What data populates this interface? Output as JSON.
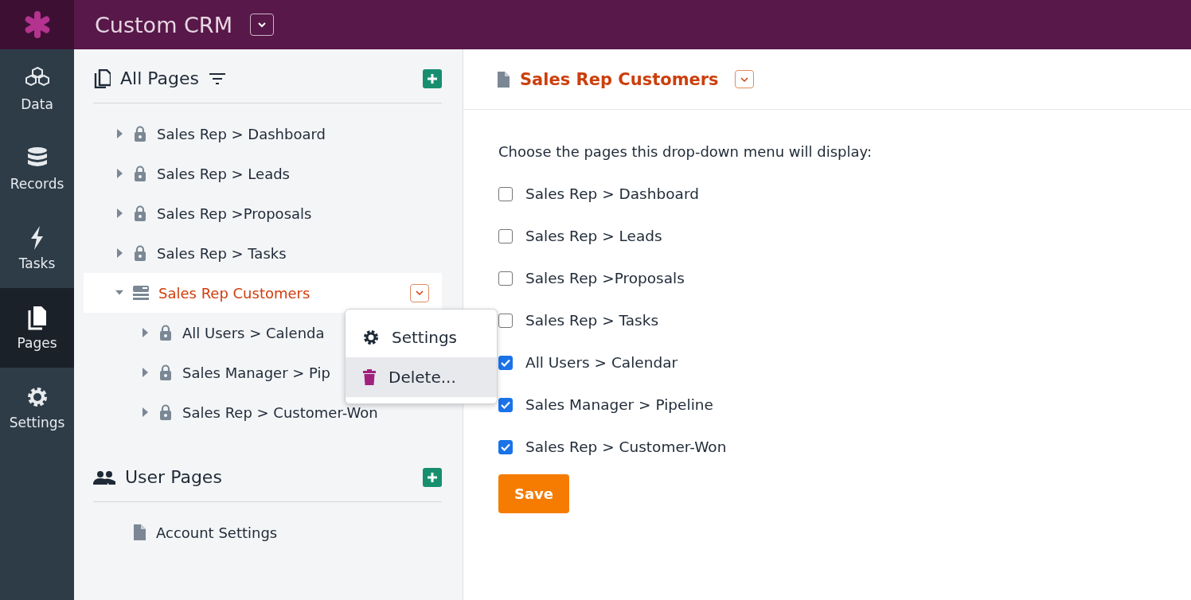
{
  "app": {
    "title": "Custom CRM"
  },
  "nav": [
    {
      "label": "Data",
      "kind": "data",
      "selected": false
    },
    {
      "label": "Records",
      "kind": "records",
      "selected": false
    },
    {
      "label": "Tasks",
      "kind": "tasks",
      "selected": false
    },
    {
      "label": "Pages",
      "kind": "pages",
      "selected": true
    },
    {
      "label": "Settings",
      "kind": "settings",
      "selected": false
    }
  ],
  "sections": [
    {
      "title": "All Pages",
      "kind": "pages",
      "items": [
        {
          "label": "Sales Rep > Dashboard",
          "kind": "locked",
          "expanded": false,
          "selected": false
        },
        {
          "label": "Sales Rep > Leads",
          "kind": "locked",
          "expanded": false,
          "selected": false
        },
        {
          "label": "Sales Rep >Proposals",
          "kind": "locked",
          "expanded": false,
          "selected": false
        },
        {
          "label": "Sales Rep > Tasks",
          "kind": "locked",
          "expanded": false,
          "selected": false
        },
        {
          "label": "Sales Rep Customers",
          "kind": "menu",
          "expanded": true,
          "selected": true,
          "children": [
            {
              "label": "All Users > Calenda",
              "kind": "locked",
              "expanded": false,
              "selected": false
            },
            {
              "label": "Sales Manager > Pip",
              "kind": "locked",
              "expanded": false,
              "selected": false
            },
            {
              "label": "Sales Rep > Customer-Won",
              "kind": "locked",
              "expanded": false,
              "selected": false
            }
          ]
        }
      ]
    },
    {
      "title": "User Pages",
      "kind": "users",
      "items": [
        {
          "label": "Account Settings",
          "kind": "page",
          "selected": false
        }
      ]
    }
  ],
  "context_menu": [
    {
      "label": "Settings",
      "kind": "settings",
      "selected": false
    },
    {
      "label": "Delete...",
      "kind": "delete",
      "selected": true
    }
  ],
  "main": {
    "title": "Sales Rep Customers",
    "prompt": "Choose the pages this drop-down menu will display:",
    "options": [
      {
        "label": "Sales Rep > Dashboard",
        "checked": false
      },
      {
        "label": "Sales Rep > Leads",
        "checked": false
      },
      {
        "label": "Sales Rep >Proposals",
        "checked": false
      },
      {
        "label": "Sales Rep > Tasks",
        "checked": false
      },
      {
        "label": "All Users > Calendar",
        "checked": true
      },
      {
        "label": "Sales Manager > Pipeline",
        "checked": true
      },
      {
        "label": "Sales Rep > Customer-Won",
        "checked": true
      }
    ],
    "button": "Save"
  }
}
